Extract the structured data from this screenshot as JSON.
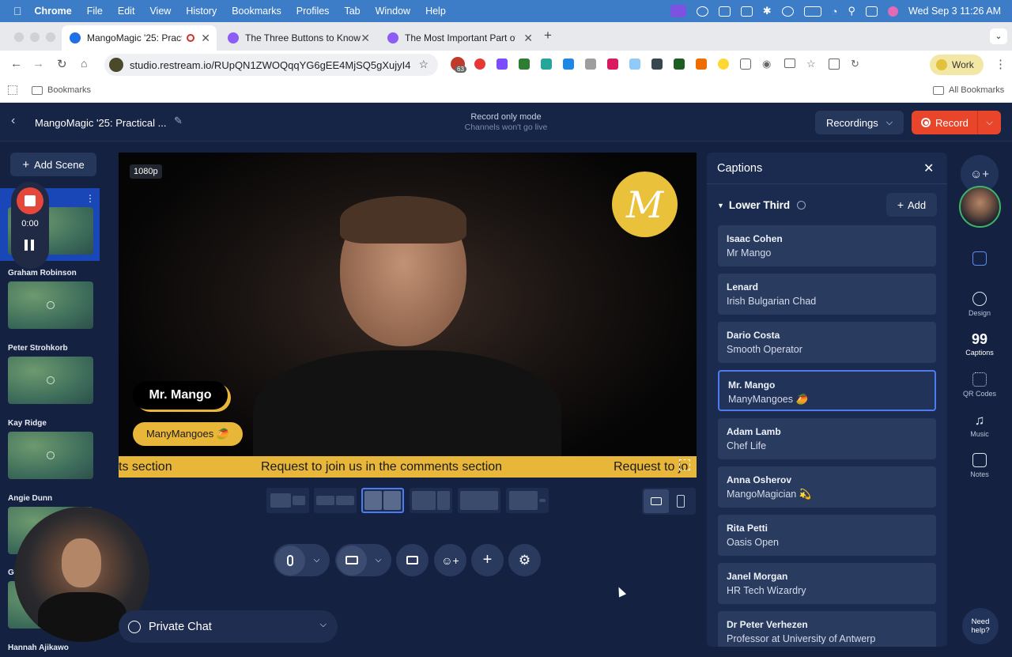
{
  "macos": {
    "app_name": "Chrome",
    "menus": [
      "File",
      "Edit",
      "View",
      "History",
      "Bookmarks",
      "Profiles",
      "Tab",
      "Window",
      "Help"
    ],
    "clock": "Wed Sep 3  11:26 AM"
  },
  "browser": {
    "tabs": [
      {
        "title": "MangoMagic '25: Practica",
        "active": true
      },
      {
        "title": "The Three Buttons to Know",
        "active": false
      },
      {
        "title": "The Most Important Part of th",
        "active": false
      }
    ],
    "url": "studio.restream.io/RUpQN1ZWOQqqYG6gEE4MjSQ5gXujyI4",
    "extension_badge": "63",
    "profile_label": "Work",
    "bookmarks_folder": "Bookmarks",
    "all_bookmarks": "All Bookmarks"
  },
  "header": {
    "title": "MangoMagic '25: Practical ...",
    "mode_title": "Record only mode",
    "mode_subtitle": "Channels won't go live",
    "recordings_label": "Recordings",
    "record_label": "Record"
  },
  "left_panel": {
    "add_scene_label": "Add Scene",
    "recorder_time": "0:00",
    "scenes": [
      {
        "label": "Graham Robinson"
      },
      {
        "label": "Peter Strohkorb"
      },
      {
        "label": "Kay Ridge"
      },
      {
        "label": "Angie Dunn"
      },
      {
        "label": "Gi"
      },
      {
        "label": "Hannah Ajikawo"
      }
    ]
  },
  "stage": {
    "resolution_badge": "1080p",
    "lower_third_name": "Mr. Mango",
    "lower_third_title": "ManyMangoes 🥭",
    "ticker_fragment_left": "ts section",
    "ticker_text": "Request to join us in the comments section",
    "ticker_fragment_right": "Request to jo"
  },
  "chat": {
    "label": "Private Chat"
  },
  "captions": {
    "title": "Captions",
    "section_title": "Lower Third",
    "add_label": "Add",
    "items": [
      {
        "name": "Isaac Cohen",
        "subtitle": "Mr Mango"
      },
      {
        "name": "Lenard",
        "subtitle": "Irish Bulgarian Chad"
      },
      {
        "name": "Dario Costa",
        "subtitle": "Smooth Operator"
      },
      {
        "name": "Mr. Mango",
        "subtitle": "ManyMangoes 🥭",
        "selected": true
      },
      {
        "name": "Adam Lamb",
        "subtitle": "Chef Life"
      },
      {
        "name": "Anna Osherov",
        "subtitle": "MangoMagician 💫"
      },
      {
        "name": "Rita Petti",
        "subtitle": "Oasis Open"
      },
      {
        "name": "Janel Morgan",
        "subtitle": "HR Tech Wizardry"
      },
      {
        "name": "Dr Peter Verhezen",
        "subtitle": "Professor at University of Antwerp"
      }
    ]
  },
  "right_rail": {
    "items": [
      {
        "label": "Design"
      },
      {
        "label": "Captions"
      },
      {
        "label": "QR Codes"
      },
      {
        "label": "Music"
      },
      {
        "label": "Notes"
      }
    ],
    "help_label_1": "Need",
    "help_label_2": "help?"
  },
  "colors": {
    "accent_record": "#e8452a",
    "brand_yellow": "#e8b73a",
    "selected_border": "#4d7cf0",
    "app_bg": "#142140"
  }
}
